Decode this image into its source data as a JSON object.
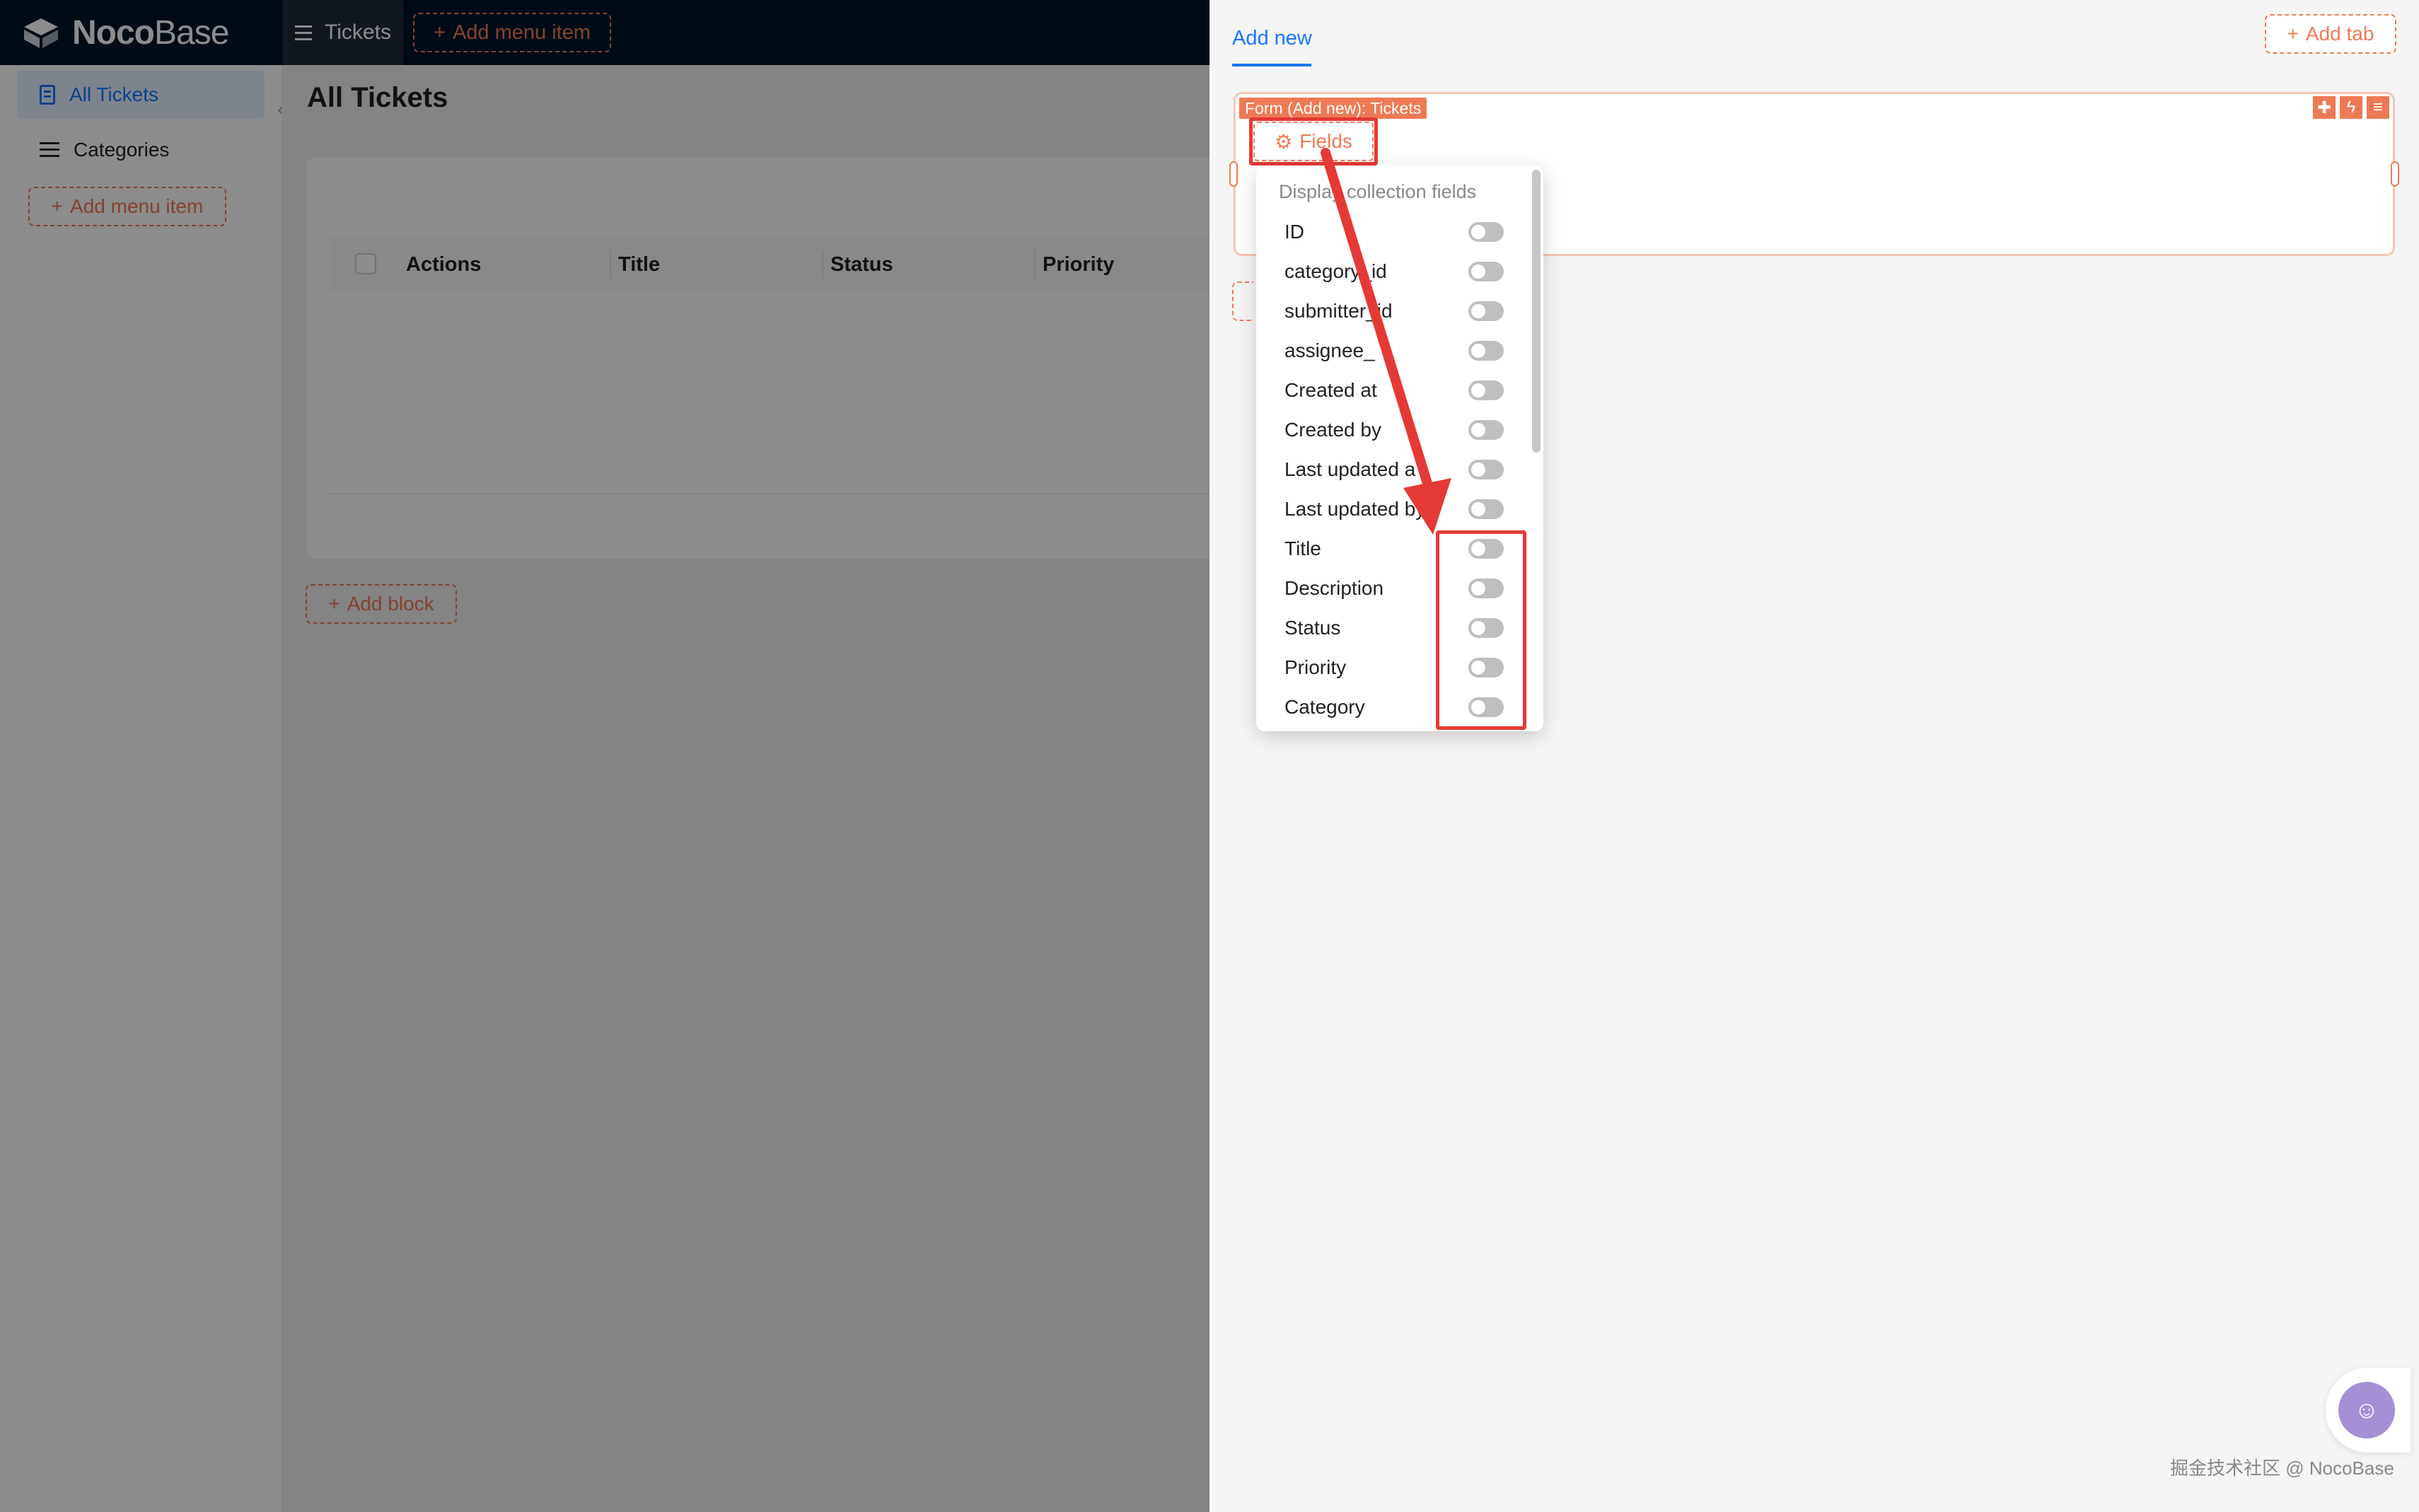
{
  "app": {
    "logo_bold": "Noco",
    "logo_light": "Base"
  },
  "topbar": {
    "tickets_tab": "Tickets",
    "add_menu_item": "Add menu item"
  },
  "sidebar": {
    "items": [
      {
        "label": "All Tickets",
        "active": true
      },
      {
        "label": "Categories",
        "active": false
      }
    ],
    "add_menu_item": "Add menu item"
  },
  "main": {
    "page_title": "All Tickets",
    "columns": [
      "Actions",
      "Title",
      "Status",
      "Priority"
    ],
    "add_block": "Add block"
  },
  "drawer": {
    "tab": "Add new",
    "add_tab": "Add tab",
    "form_badge": "Form (Add new): Tickets",
    "fields_button": "Fields",
    "dropdown": {
      "header": "Display collection fields",
      "items": [
        {
          "label": "ID",
          "enabled": false
        },
        {
          "label": "category_id",
          "enabled": false
        },
        {
          "label": "submitter_id",
          "enabled": false
        },
        {
          "label": "assignee_",
          "enabled": false
        },
        {
          "label": "Created at",
          "enabled": false
        },
        {
          "label": "Created by",
          "enabled": false
        },
        {
          "label": "Last updated a",
          "enabled": false
        },
        {
          "label": "Last updated by",
          "enabled": false
        },
        {
          "label": "Title",
          "enabled": false
        },
        {
          "label": "Description",
          "enabled": false
        },
        {
          "label": "Status",
          "enabled": false
        },
        {
          "label": "Priority",
          "enabled": false
        },
        {
          "label": "Category",
          "enabled": false
        }
      ]
    }
  },
  "watermark": "掘金技术社区 @ NocoBase",
  "colors": {
    "accent": "#ee7a55",
    "primary": "#1677ff",
    "annotation": "#e53935",
    "header_bg": "#001529"
  }
}
